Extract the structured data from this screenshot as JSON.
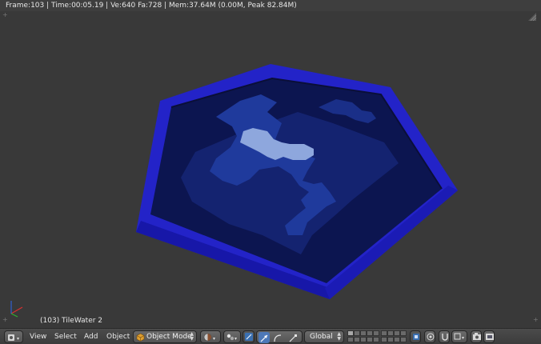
{
  "stats_bar": {
    "text": "Frame:103 | Time:00:05.19 | Ve:640 Fa:728 | Mem:37.64M (0.00M, Peak 82.84M)"
  },
  "viewport": {
    "object_info": "(103) TileWater 2",
    "background_color": "#393939",
    "tile_colors": {
      "rim": "#2323c8",
      "rim_shadow": "#1414a0",
      "water_deep": "#0c1550",
      "water_mid": "#142370",
      "water_light": "#1f3a9c",
      "foam": "#8ea7dd"
    }
  },
  "header": {
    "menu_view": "View",
    "menu_select": "Select",
    "menu_add": "Add",
    "menu_object": "Object",
    "mode_label": "Object Mode",
    "orientation_label": "Global",
    "icons": [
      "editor-type-icon",
      "viewport-shading-icon",
      "pivot-point-icon",
      "manipulator-toggle-icon",
      "translate-icon",
      "rotate-icon",
      "scale-icon",
      "layers-grid-icon",
      "lock-layers-icon",
      "snap-icon",
      "proportional-edit-icon",
      "render-icon",
      "opengl-render-icon"
    ]
  }
}
